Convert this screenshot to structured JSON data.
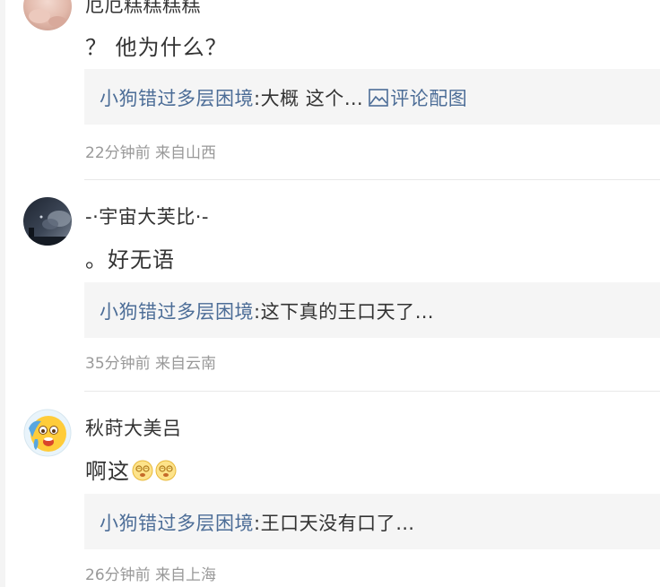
{
  "comments": [
    {
      "username": "厄厄糕糕糕糕",
      "content": "？ 他为什么？",
      "reply": {
        "user": "小狗错过多层困境",
        "colon": ":",
        "text": "大概 这个…",
        "pic_label": "评论配图",
        "pic_icon": "image-icon"
      },
      "time": "22分钟前",
      "location": "来自山西"
    },
    {
      "username": "-·宇宙大芙比·-",
      "content": "。好无语",
      "reply": {
        "user": "小狗错过多层困境",
        "colon": ":",
        "text": "这下真的王口天了…"
      },
      "time": "35分钟前",
      "location": "来自云南"
    },
    {
      "username": "秋莳大美吕",
      "content": "啊这",
      "content_emojis": [
        "dizzy-face-emoji",
        "dizzy-face-emoji"
      ],
      "reply": {
        "user": "小狗错过多层困境",
        "colon": ":",
        "text": "王口天没有口了…"
      },
      "time": "26分钟前",
      "location": "来自上海"
    }
  ],
  "colors": {
    "link": "#4c6d97",
    "text": "#333333",
    "meta": "#999999",
    "reply_bg": "#f5f5f5",
    "divider": "#e8e8e8"
  }
}
